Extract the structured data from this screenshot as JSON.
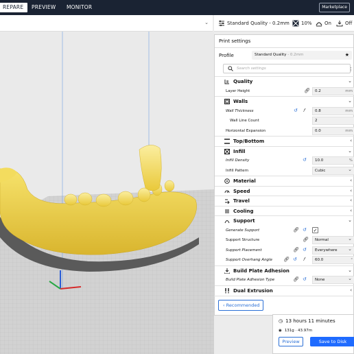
{
  "topbar": {
    "tabs": [
      {
        "label": "REPARE",
        "active": true
      },
      {
        "label": "PREVIEW",
        "active": false
      },
      {
        "label": "MONITOR",
        "active": false
      }
    ],
    "marketplace": "Marketplace"
  },
  "quick": {
    "profile": "Standard Quality - 0.2mm",
    "infill": "10%",
    "support": "On",
    "adhesion": "Off"
  },
  "panel": {
    "title": "Print settings",
    "profile_label": "Profile",
    "profile_name": "Standard Quality",
    "profile_sub": "- 0.2mm",
    "search_placeholder": "Search settings",
    "rows": {
      "quality": "Quality",
      "layer_height": "Layer Height",
      "layer_height_val": "0.2",
      "walls": "Walls",
      "wall_thickness": "Wall Thickness",
      "wall_thickness_val": "0.8",
      "wall_line_count": "Wall Line Count",
      "wall_line_count_val": "2",
      "horizontal_expansion": "Horizontal Expansion",
      "horizontal_expansion_val": "0.0",
      "top_bottom": "Top/Bottom",
      "infill": "Infill",
      "infill_density": "Infill Density",
      "infill_density_val": "10.0",
      "infill_pattern": "Infill Pattern",
      "infill_pattern_val": "Cubic",
      "material": "Material",
      "speed": "Speed",
      "travel": "Travel",
      "cooling": "Cooling",
      "support": "Support",
      "generate_support": "Generate Support",
      "support_structure": "Support Structure",
      "support_structure_val": "Normal",
      "support_placement": "Support Placement",
      "support_placement_val": "Everywhere",
      "support_overhang": "Support Overhang Angle",
      "support_overhang_val": "60.0",
      "build_plate_adhesion": "Build Plate Adhesion",
      "adhesion_type": "Build Plate Adhesion Type",
      "adhesion_type_val": "None",
      "dual_extrusion": "Dual Extrusion",
      "unit_mm": "mm",
      "unit_pct": "%",
      "unit_deg": "°"
    },
    "recommended": "Recommended"
  },
  "estimate": {
    "time": "13 hours 11 minutes",
    "material": "131g · 43.97m",
    "preview": "Preview",
    "save": "Save to Disk"
  },
  "colors": {
    "topbar": "#1a2333",
    "accent": "#1f6bff",
    "model": "#f5e067",
    "model_shadow": "#e8c63a"
  }
}
